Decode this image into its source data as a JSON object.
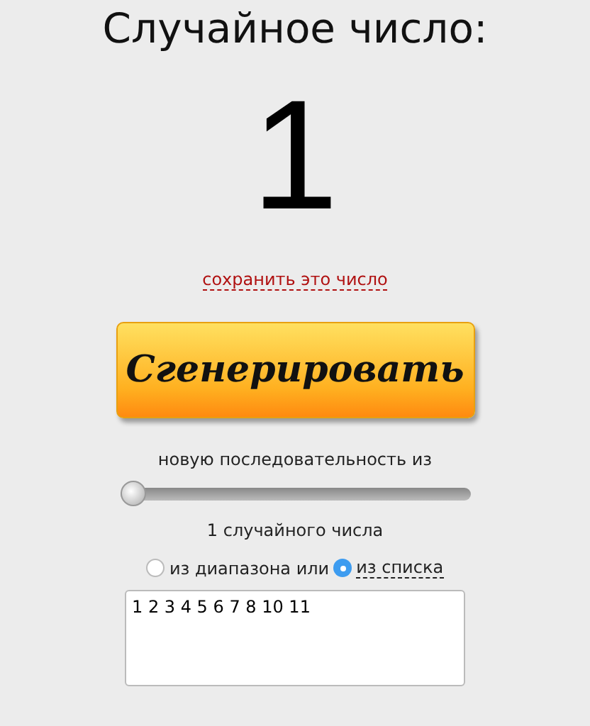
{
  "title": "Случайное число:",
  "result": "1",
  "save_link": "сохранить это число",
  "generate_button": "Сгенерировать",
  "sequence_label": "новую последовательность из",
  "count_slider": {
    "level": 0
  },
  "count_label": "1 случайного числа",
  "source_options": [
    {
      "label": "из диапазона или",
      "selected": false,
      "kind": "plain"
    },
    {
      "label": "из списка",
      "selected": true,
      "kind": "link"
    }
  ],
  "list_field": {
    "value": "1 2 3 4 5 6 7 8 10 11"
  }
}
